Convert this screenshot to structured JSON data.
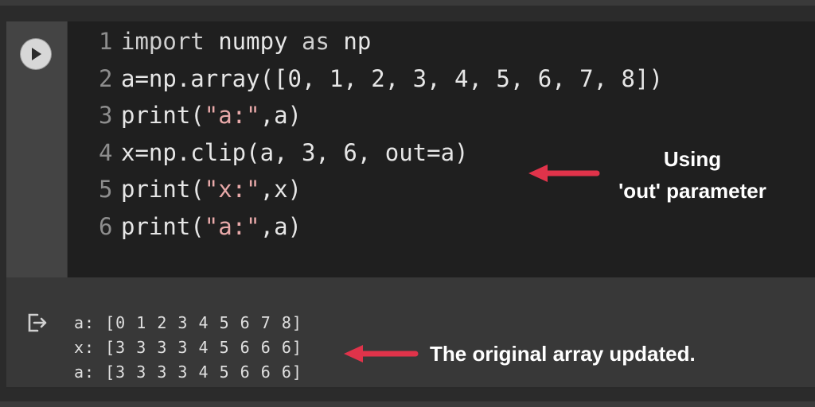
{
  "notebook": {
    "run_button_icon": "play-icon",
    "code_lines": [
      {
        "num": "1",
        "parts": [
          {
            "t": "import",
            "c": "kw"
          },
          {
            "t": " numpy ",
            "c": ""
          },
          {
            "t": "as",
            "c": "kw"
          },
          {
            "t": " np",
            "c": ""
          }
        ]
      },
      {
        "num": "2",
        "parts": [
          {
            "t": "a=np.array([0, 1, 2, 3, 4, 5, 6, 7, 8])",
            "c": ""
          }
        ]
      },
      {
        "num": "3",
        "parts": [
          {
            "t": "print(",
            "c": ""
          },
          {
            "t": "\"a:\"",
            "c": "str"
          },
          {
            "t": ",a)",
            "c": ""
          }
        ]
      },
      {
        "num": "4",
        "parts": [
          {
            "t": "x=np.clip(a, 3, 6, out=a)",
            "c": ""
          }
        ]
      },
      {
        "num": "5",
        "parts": [
          {
            "t": "print(",
            "c": ""
          },
          {
            "t": "\"x:\"",
            "c": "str"
          },
          {
            "t": ",x)",
            "c": ""
          }
        ]
      },
      {
        "num": "6",
        "parts": [
          {
            "t": "print(",
            "c": ""
          },
          {
            "t": "\"a:\"",
            "c": "str"
          },
          {
            "t": ",a)",
            "c": ""
          }
        ]
      }
    ],
    "output_icon": "output-redirect-icon",
    "output_lines": [
      "a: [0 1 2 3 4 5 6 7 8]",
      "x: [3 3 3 3 4 5 6 6 6]",
      "a: [3 3 3 3 4 5 6 6 6]"
    ]
  },
  "annotations": {
    "out_param_line1": "Using",
    "out_param_line2": "'out' parameter",
    "original_updated": "The original array updated."
  },
  "colors": {
    "arrow": "#e0334a",
    "editor_bg": "#1f1f1f",
    "string": "#e8a9a9"
  }
}
